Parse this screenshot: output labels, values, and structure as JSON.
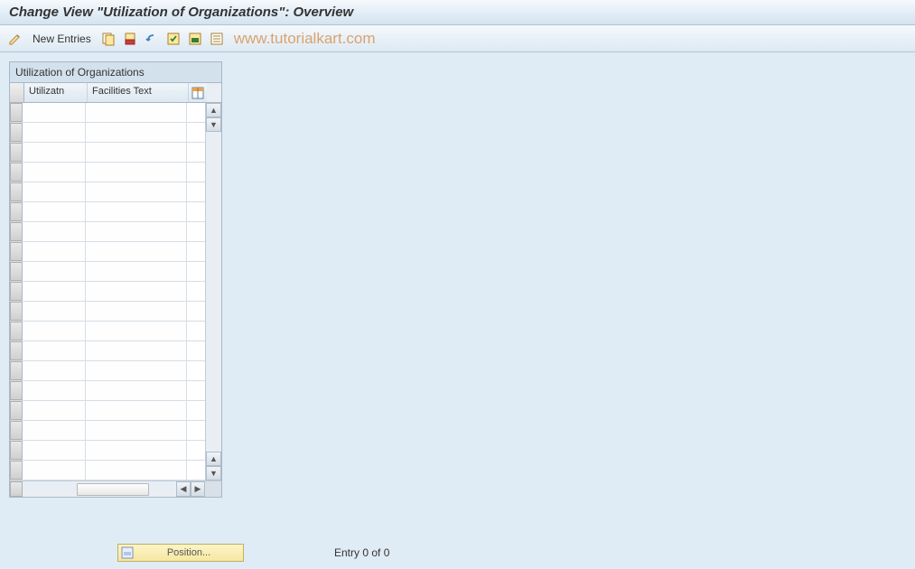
{
  "title": "Change View \"Utilization of Organizations\": Overview",
  "toolbar": {
    "new_entries_label": "New Entries"
  },
  "watermark": "www.tutorialkart.com",
  "table": {
    "title": "Utilization of Organizations",
    "columns": {
      "utilizatn": "Utilizatn",
      "facilities_text": "Facilities Text"
    },
    "row_count": 19
  },
  "footer": {
    "position_label": "Position...",
    "entry_status": "Entry 0 of 0"
  }
}
